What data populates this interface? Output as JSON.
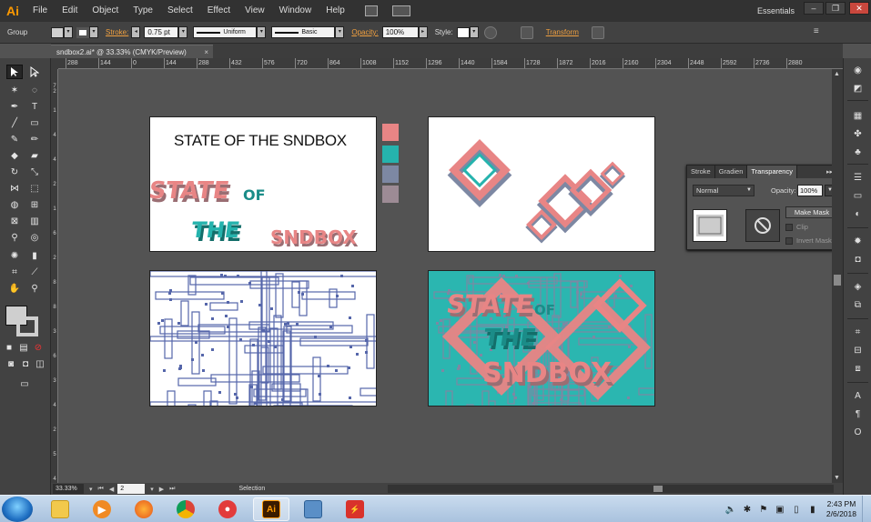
{
  "app": {
    "logo": "Ai"
  },
  "menu": [
    "File",
    "Edit",
    "Object",
    "Type",
    "Select",
    "Effect",
    "View",
    "Window",
    "Help"
  ],
  "workspace": "Essentials",
  "window_controls": {
    "minimize": "–",
    "maximize": "❐",
    "close": "✕"
  },
  "control_bar": {
    "selection_label": "Group",
    "stroke_label": "Stroke:",
    "stroke_weight": "0.75 pt",
    "variable_width": "Uniform",
    "brush": "Basic",
    "opacity_label": "Opacity:",
    "opacity_value": "100%",
    "style_label": "Style:",
    "transform_label": "Transform"
  },
  "document_tab": {
    "title": "sndbox2.ai* @ 33.33% (CMYK/Preview)",
    "close": "×"
  },
  "ruler_h": [
    "288",
    "144",
    "0",
    "144",
    "288",
    "432",
    "576",
    "720",
    "864",
    "1008",
    "1152",
    "1296",
    "1440",
    "1584",
    "1728",
    "1872",
    "2016",
    "2160",
    "2304",
    "2448",
    "2592",
    "2736",
    "2880"
  ],
  "ruler_v": [
    "72",
    "1",
    "4",
    "4",
    "2",
    "1",
    "6",
    "2",
    "8",
    "8",
    "3",
    "6",
    "3",
    "4",
    "2",
    "5",
    "4"
  ],
  "artboards": {
    "ab1_title": "STATE OF THE SNDBOX",
    "ab1_logo_words": [
      "STATE",
      "OF",
      "THE",
      "SNDBOX"
    ],
    "ab4_words": [
      "STATE",
      "OF",
      "THE",
      "SNDBOX"
    ]
  },
  "swatch_colors": [
    "#e88585",
    "#25b3ad",
    "#7d88a3",
    "#9d8b95"
  ],
  "colors": {
    "pink": "#e88585",
    "teal": "#25b3ad",
    "slate": "#7d88a3",
    "mauve": "#9d8b95",
    "blue_art": "#5566aa"
  },
  "transparency_panel": {
    "tabs": [
      "Stroke",
      "Gradien",
      "Transparency"
    ],
    "blend_mode": "Normal",
    "opacity_label": "Opacity:",
    "opacity_value": "100%",
    "make_mask": "Make Mask",
    "clip": "Clip",
    "invert_mask": "Invert Mask"
  },
  "status_bar": {
    "zoom": "33.33%",
    "artboard_number": "2",
    "tool": "Selection"
  },
  "taskbar": {
    "apps": [
      "file-explorer",
      "media-player",
      "firefox",
      "chrome",
      "screen-recorder",
      "illustrator",
      "image-viewer",
      "pdf-reader"
    ],
    "time": "2:43 PM",
    "date": "2/6/2018"
  }
}
